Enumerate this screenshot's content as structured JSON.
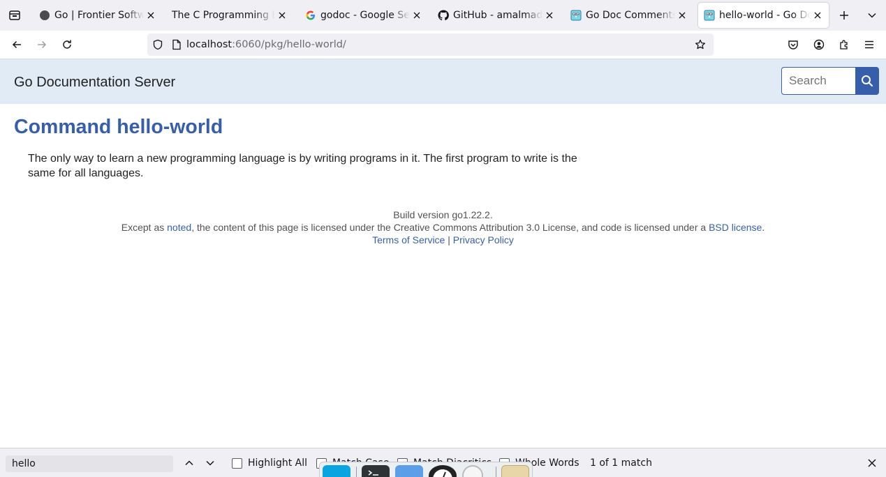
{
  "browser": {
    "tabs": [
      {
        "title": "Go | Frontier Software",
        "favicon": "circle-favicon",
        "active": false
      },
      {
        "title": "The C Programming Language",
        "favicon": "none",
        "active": false
      },
      {
        "title": "godoc - Google Search",
        "favicon": "google-favicon",
        "active": false
      },
      {
        "title": "GitHub - amalmadhu",
        "favicon": "github-favicon",
        "active": false
      },
      {
        "title": "Go Doc Comments",
        "favicon": "gopher-favicon",
        "active": false
      },
      {
        "title": "hello-world - Go Documentation Server",
        "favicon": "gopher-favicon",
        "active": true
      }
    ],
    "url": {
      "host": "localhost",
      "rest": ":6060/pkg/hello-world/"
    }
  },
  "page": {
    "site_title": "Go Documentation Server",
    "search_placeholder": "Search",
    "heading": "Command hello-world",
    "doc_text": "The only way to learn a new programming language is by writing programs in it. The first program to write is the same for all languages.",
    "footer": {
      "build": "Build version go1.22.2.",
      "license_pre": "Except as ",
      "license_link1": "noted",
      "license_mid": ", the content of this page is licensed under the Creative Commons Attribution 3.0 License, and code is licensed under a ",
      "license_link2": "BSD license",
      "license_post": ".",
      "terms": "Terms of Service",
      "sep": "|",
      "privacy": "Privacy Policy"
    }
  },
  "findbar": {
    "query": "hello",
    "highlight_all": "Highlight All",
    "match_case": "Match Case",
    "match_diacritics": "Match Diacritics",
    "whole_words": "Whole Words",
    "status": "1 of 1 match"
  },
  "colors": {
    "link_blue": "#375eab",
    "header_bg": "#e0ebf5",
    "chrome_bg": "#f0f0f4"
  }
}
